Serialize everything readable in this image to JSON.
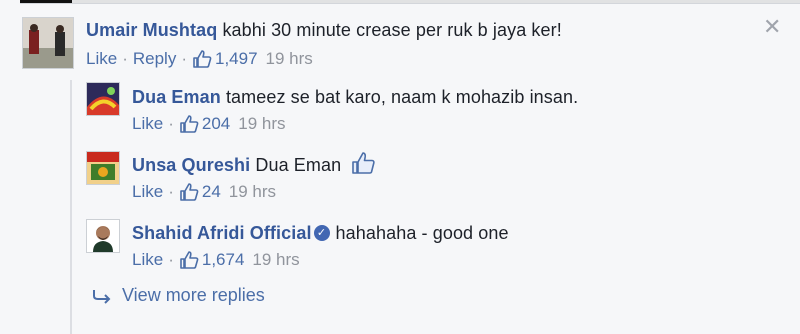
{
  "comments": [
    {
      "author": "Umair Mushtaq",
      "text": "kabhi 30 minute crease per ruk b jaya ker!",
      "like_label": "Like",
      "reply_label": "Reply",
      "likes": "1,497",
      "time": "19 hrs"
    }
  ],
  "replies": [
    {
      "author": "Dua Eman",
      "text": "tameez se bat karo, naam k mohazib insan.",
      "like_label": "Like",
      "likes": "204",
      "time": "19 hrs"
    },
    {
      "author": "Unsa Qureshi",
      "text": "Dua Eman",
      "like_label": "Like",
      "likes": "24",
      "time": "19 hrs"
    },
    {
      "author": "Shahid Afridi Official",
      "text": "hahahaha - good one",
      "like_label": "Like",
      "likes": "1,674",
      "time": "19 hrs"
    }
  ],
  "view_more": "View more replies",
  "close_glyph": "✕",
  "separator": "·",
  "colors": {
    "link": "#365899",
    "meta": "#90949c",
    "verified": "#4267b2"
  }
}
